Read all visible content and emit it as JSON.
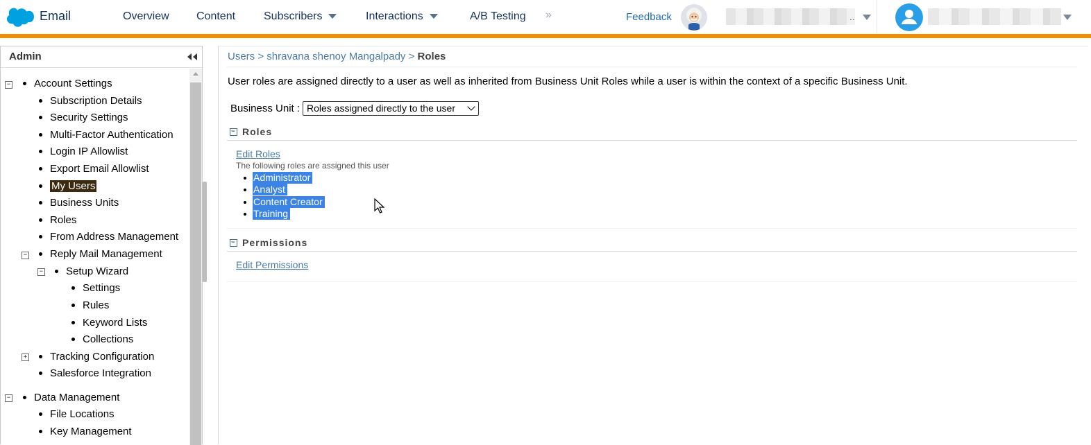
{
  "header": {
    "app_name": "Email",
    "nav": {
      "overview": "Overview",
      "content": "Content",
      "subscribers": "Subscribers",
      "interactions": "Interactions",
      "ab_testing": "A/B Testing"
    },
    "more": "»",
    "feedback": "Feedback",
    "account_ellipsis": ".."
  },
  "sidebar": {
    "title": "Admin",
    "items": {
      "account_settings": "Account Settings",
      "subscription_details": "Subscription Details",
      "security_settings": "Security Settings",
      "mfa": "Multi-Factor Authentication",
      "login_ip": "Login IP Allowlist",
      "export_email": "Export Email Allowlist",
      "my_users": "My Users",
      "business_units": "Business Units",
      "roles": "Roles",
      "from_address": "From Address Management",
      "reply_mail": "Reply Mail Management",
      "setup_wizard": "Setup Wizard",
      "settings": "Settings",
      "rules": "Rules",
      "keyword_lists": "Keyword Lists",
      "collections": "Collections",
      "tracking_config": "Tracking Configuration",
      "sf_integration": "Salesforce Integration",
      "data_management": "Data Management",
      "file_locations": "File Locations",
      "key_management": "Key Management"
    },
    "toggles": {
      "collapse": "−",
      "expand": "+"
    }
  },
  "main": {
    "breadcrumb": {
      "users": "Users",
      "sep": ">",
      "user_name": "shravana shenoy Mangalpady",
      "current": "Roles"
    },
    "intro": "User roles are assigned directly to a user as well as inherited from Business Unit Roles while a user is within the context of a specific Business Unit.",
    "business_unit_label": "Business Unit :",
    "business_unit_value": "Roles assigned directly to the user",
    "roles_section": {
      "title": "Roles",
      "edit_link": "Edit Roles",
      "note": "The following roles are assigned this user",
      "roles": [
        "Administrator",
        "Analyst",
        "Content Creator",
        "Training"
      ]
    },
    "permissions_section": {
      "title": "Permissions",
      "edit_link": "Edit Permissions"
    }
  },
  "colors": {
    "accent_orange": "#f18b00",
    "nav_text": "#16325c",
    "link": "#4a7aa8",
    "selection": "#3b84e6",
    "selected_tree": "#3b2a10"
  }
}
